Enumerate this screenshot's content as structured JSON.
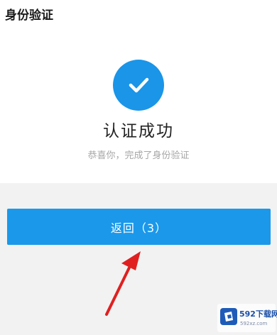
{
  "header": {
    "title": "身份验证"
  },
  "result": {
    "icon": "check-icon",
    "title": "认证成功",
    "subtitle": "恭喜你，完成了身份验证"
  },
  "actions": {
    "return_label": "返回（3）"
  },
  "watermark": {
    "brand": "592下载网",
    "url": "592xz.com"
  },
  "colors": {
    "accent": "#1b98ea",
    "arrow": "#e02020"
  }
}
